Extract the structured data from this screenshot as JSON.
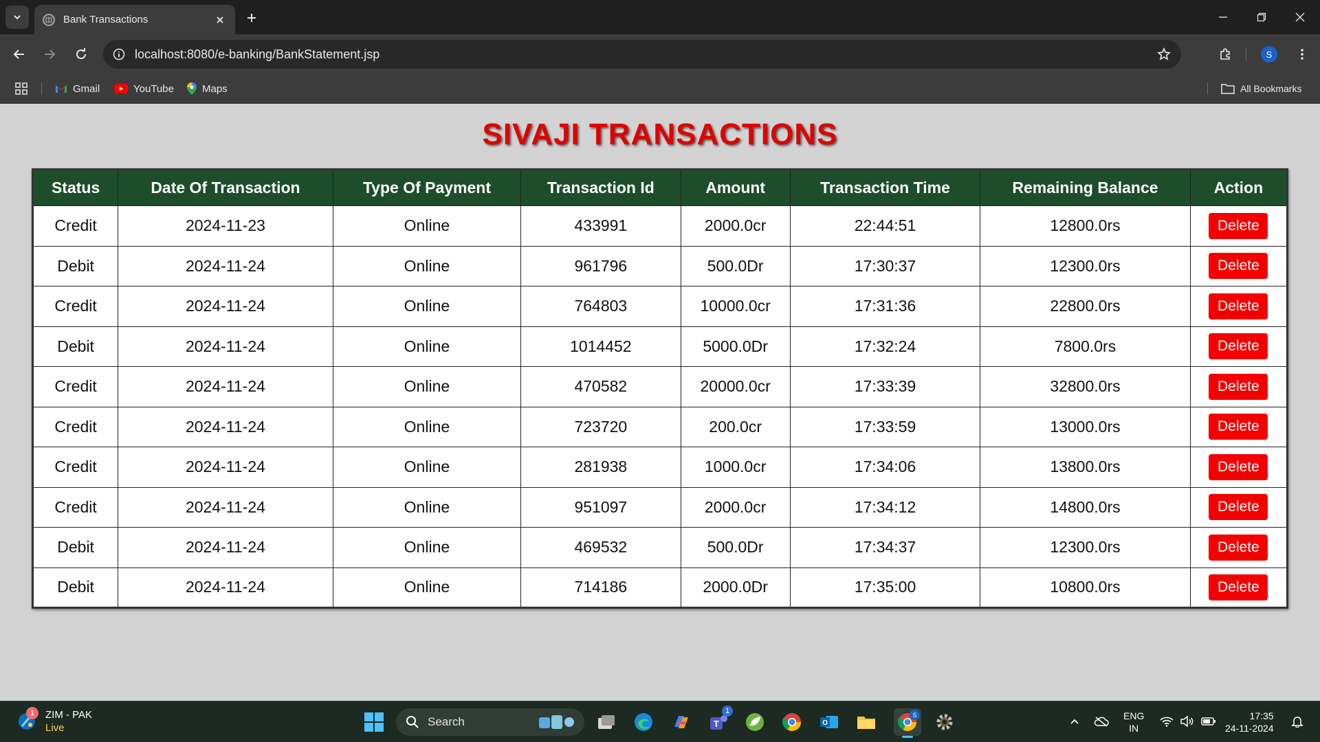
{
  "browser": {
    "tab_title": "Bank Transactions",
    "url": "localhost:8080/e-banking/BankStatement.jsp",
    "profile_initial": "S",
    "bookmarks": [
      {
        "label": "Gmail",
        "icon": "gmail-icon"
      },
      {
        "label": "YouTube",
        "icon": "youtube-icon"
      },
      {
        "label": "Maps",
        "icon": "maps-icon"
      }
    ],
    "all_bookmarks_label": "All Bookmarks"
  },
  "page": {
    "heading": "SIVAJI TRANSACTIONS",
    "columns": [
      "Status",
      "Date Of Transaction",
      "Type Of Payment",
      "Transaction Id",
      "Amount",
      "Transaction Time",
      "Remaining Balance",
      "Action"
    ],
    "delete_label": "Delete",
    "rows": [
      {
        "status": "Credit",
        "date": "2024-11-23",
        "type": "Online",
        "id": "433991",
        "amount": "2000.0cr",
        "time": "22:44:51",
        "balance": "12800.0rs"
      },
      {
        "status": "Debit",
        "date": "2024-11-24",
        "type": "Online",
        "id": "961796",
        "amount": "500.0Dr",
        "time": "17:30:37",
        "balance": "12300.0rs"
      },
      {
        "status": "Credit",
        "date": "2024-11-24",
        "type": "Online",
        "id": "764803",
        "amount": "10000.0cr",
        "time": "17:31:36",
        "balance": "22800.0rs"
      },
      {
        "status": "Debit",
        "date": "2024-11-24",
        "type": "Online",
        "id": "1014452",
        "amount": "5000.0Dr",
        "time": "17:32:24",
        "balance": "7800.0rs"
      },
      {
        "status": "Credit",
        "date": "2024-11-24",
        "type": "Online",
        "id": "470582",
        "amount": "20000.0cr",
        "time": "17:33:39",
        "balance": "32800.0rs"
      },
      {
        "status": "Credit",
        "date": "2024-11-24",
        "type": "Online",
        "id": "723720",
        "amount": "200.0cr",
        "time": "17:33:59",
        "balance": "13000.0rs"
      },
      {
        "status": "Credit",
        "date": "2024-11-24",
        "type": "Online",
        "id": "281938",
        "amount": "1000.0cr",
        "time": "17:34:06",
        "balance": "13800.0rs"
      },
      {
        "status": "Credit",
        "date": "2024-11-24",
        "type": "Online",
        "id": "951097",
        "amount": "2000.0cr",
        "time": "17:34:12",
        "balance": "14800.0rs"
      },
      {
        "status": "Debit",
        "date": "2024-11-24",
        "type": "Online",
        "id": "469532",
        "amount": "500.0Dr",
        "time": "17:34:37",
        "balance": "12300.0rs"
      },
      {
        "status": "Debit",
        "date": "2024-11-24",
        "type": "Online",
        "id": "714186",
        "amount": "2000.0Dr",
        "time": "17:35:00",
        "balance": "10800.0rs"
      }
    ],
    "colors": {
      "heading": "#e00000",
      "header_bg": "#1d4d2b",
      "delete_bg": "#f40000",
      "page_bg": "#d3d3d3"
    }
  },
  "taskbar": {
    "news_badge": "1",
    "news_title": "ZIM - PAK",
    "news_sub": "Live",
    "search_label": "Search",
    "teams_badge": "1",
    "chrome_badge": "S",
    "lang_top": "ENG",
    "lang_bottom": "IN",
    "time": "17:35",
    "date": "24-11-2024"
  }
}
